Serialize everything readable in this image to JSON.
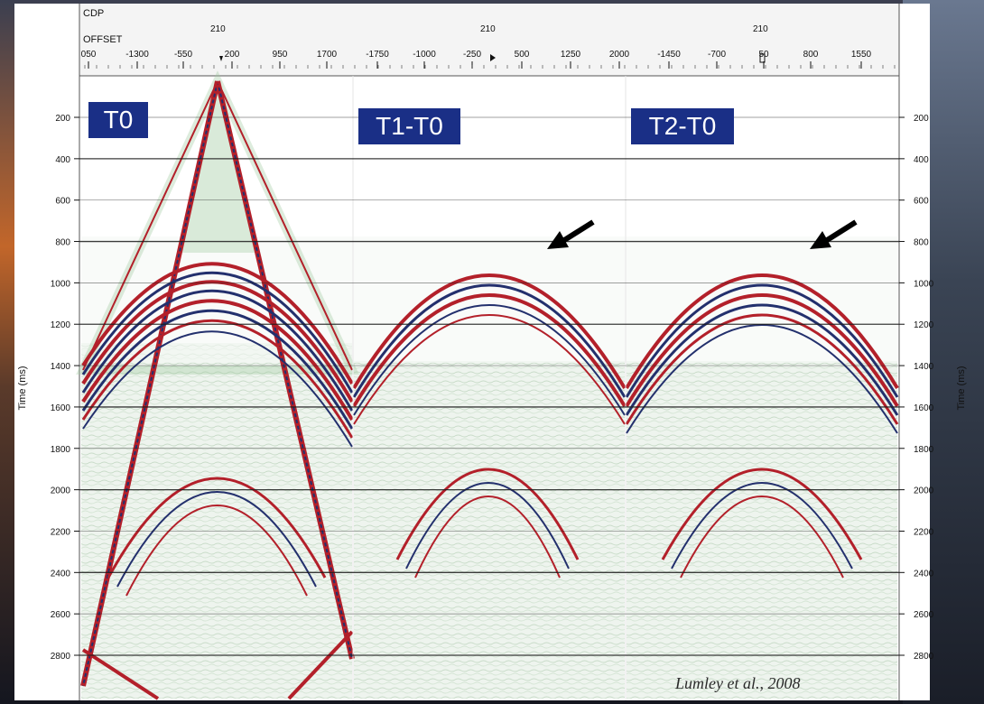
{
  "header": {
    "cdp_label": "CDP",
    "offset_label": "OFFSET",
    "cdp_values": [
      "210",
      "210",
      "210"
    ],
    "offset_ticks": [
      "050",
      "-1300",
      "-550",
      "200",
      "950",
      "1700",
      "-1750",
      "-1000",
      "-250",
      "500",
      "1250",
      "2000",
      "-1450",
      "-700",
      "50",
      "800",
      "1550"
    ]
  },
  "axis": {
    "title_left": "Time (ms)",
    "title_right": "Time (ms)",
    "time_ticks": [
      "200",
      "400",
      "600",
      "800",
      "1000",
      "1200",
      "1400",
      "1600",
      "1800",
      "2000",
      "2200",
      "2400",
      "2600",
      "2800"
    ]
  },
  "panels": [
    {
      "label": "T0"
    },
    {
      "label": "T1-T0"
    },
    {
      "label": "T2-T0"
    }
  ],
  "arrows": [
    {
      "panel": "T1-T0"
    },
    {
      "panel": "T2-T0"
    }
  ],
  "credit": "Lumley et al., 2008",
  "colors": {
    "badge": "#1a2f86",
    "badge_text": "#ffffff",
    "event_red": "#b3202a",
    "event_blue": "#23306d",
    "noise_green": "#cfe3cf",
    "gridline": "#1b1b1b"
  }
}
